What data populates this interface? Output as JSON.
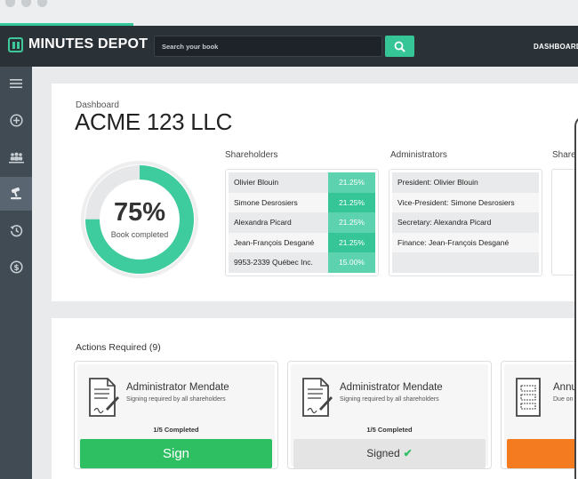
{
  "app": {
    "name": "MINUTES DEPOT"
  },
  "search": {
    "placeholder": "Search your book"
  },
  "nav": {
    "dashboard": "DASHBOARD"
  },
  "colors": {
    "accent": "#36c596",
    "topbar": "#2a3238",
    "sidebar": "#414b53",
    "sign": "#2fbf63",
    "orange": "#f47b20"
  },
  "sidebar": {
    "items": [
      {
        "icon": "menu-icon"
      },
      {
        "icon": "plus-circle-icon"
      },
      {
        "icon": "users-icon"
      },
      {
        "icon": "gavel-icon",
        "active": true
      },
      {
        "icon": "history-icon"
      },
      {
        "icon": "dollar-icon"
      }
    ]
  },
  "header": {
    "breadcrumb": "Dashboard",
    "company": "ACME 123 LLC"
  },
  "progress": {
    "percent_label": "75%",
    "label": "Book completed",
    "value": 0.75
  },
  "shareholders": {
    "title": "Shareholders",
    "rows": [
      {
        "name": "Olivier Blouin",
        "share": "21.25%"
      },
      {
        "name": "Simone Desrosiers",
        "share": "21.25%"
      },
      {
        "name": "Alexandra Picard",
        "share": "21.25%"
      },
      {
        "name": "Jean-François Desgané",
        "share": "21.25%"
      },
      {
        "name": "9953-2339 Québec Inc.",
        "share": "15.00%"
      }
    ]
  },
  "administrators": {
    "title": "Administrators",
    "rows": [
      "President: Olivier Blouin",
      "Vice-President: Simone Desrosiers",
      "Secretary: Alexandra Picard",
      "Finance: Jean-François Desgané",
      ""
    ]
  },
  "third_section": {
    "title": "Share"
  },
  "actions": {
    "title": "Actions Required (9)",
    "cards": [
      {
        "title": "Administrator Mendate",
        "subtitle": "Signing required by all shareholders",
        "completed": "1/5 Completed",
        "button": "Sign"
      },
      {
        "title": "Administrator Mendate",
        "subtitle": "Signing required by all shareholders",
        "completed": "1/5 Completed",
        "button": "Signed",
        "check": "✔"
      },
      {
        "title": "Annu",
        "subtitle": "Due on"
      }
    ]
  }
}
